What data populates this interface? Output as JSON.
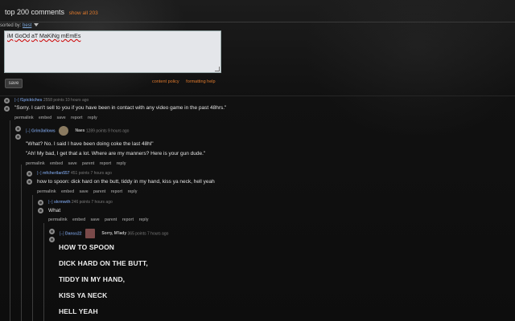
{
  "header": {
    "title": "top 200 comments",
    "show_all": "show all 203"
  },
  "sort": {
    "label": "sorted by:",
    "value": "best"
  },
  "editor": {
    "text_parts": [
      "iM",
      "GoOd",
      "aT",
      "MaKiNg",
      "mEmEs"
    ]
  },
  "form": {
    "save_label": "save",
    "content_policy": "content policy",
    "formatting_help": "formatting help"
  },
  "comments": [
    {
      "toggle": "[–]",
      "author": "f1picktches",
      "score": "2558 points 10 hours ago",
      "body": [
        "\"Sorry. I can't sell to you if you have been in contact with any video game in the past 48hrs.\""
      ],
      "actions": [
        "permalink",
        "embed",
        "save",
        "report",
        "reply"
      ]
    },
    {
      "toggle": "[–]",
      "author": "Grim3allows",
      "flair": "Naes",
      "score": "1289 points 9 hours ago",
      "body": [
        "\"What? No. I said I have been doing coke the last 48hl\"",
        "\"Ah! My bad, I get that a lot. Where are my manners? Here is your gun dude.\""
      ],
      "actions": [
        "permalink",
        "embed",
        "save",
        "parent",
        "report",
        "reply"
      ]
    },
    {
      "toggle": "[–]",
      "author": "mfcherilan557",
      "score": "451 points 7 hours ago",
      "body": [
        "how to spoon: dick hard on the butt, tiddy in my hand, kiss ya neck, hell yeah"
      ],
      "actions": [
        "permalink",
        "embed",
        "save",
        "parent",
        "report",
        "reply"
      ]
    },
    {
      "toggle": "[–]",
      "author": "skrmwth",
      "score": "246 points 7 hours ago",
      "body": [
        "What"
      ],
      "actions": [
        "permalink",
        "embed",
        "save",
        "parent",
        "report",
        "reply"
      ]
    },
    {
      "toggle": "[–]",
      "author": "Danss22",
      "flair": "Sorry, M'lady",
      "score": "365 points 7 hours ago",
      "body": [
        "HOW TO SPOON",
        "DICK HARD ON THE BUTT,",
        "TIDDY IN MY HAND,",
        "KISS YA NECK",
        "HELL YEAH"
      ],
      "actions": []
    }
  ]
}
